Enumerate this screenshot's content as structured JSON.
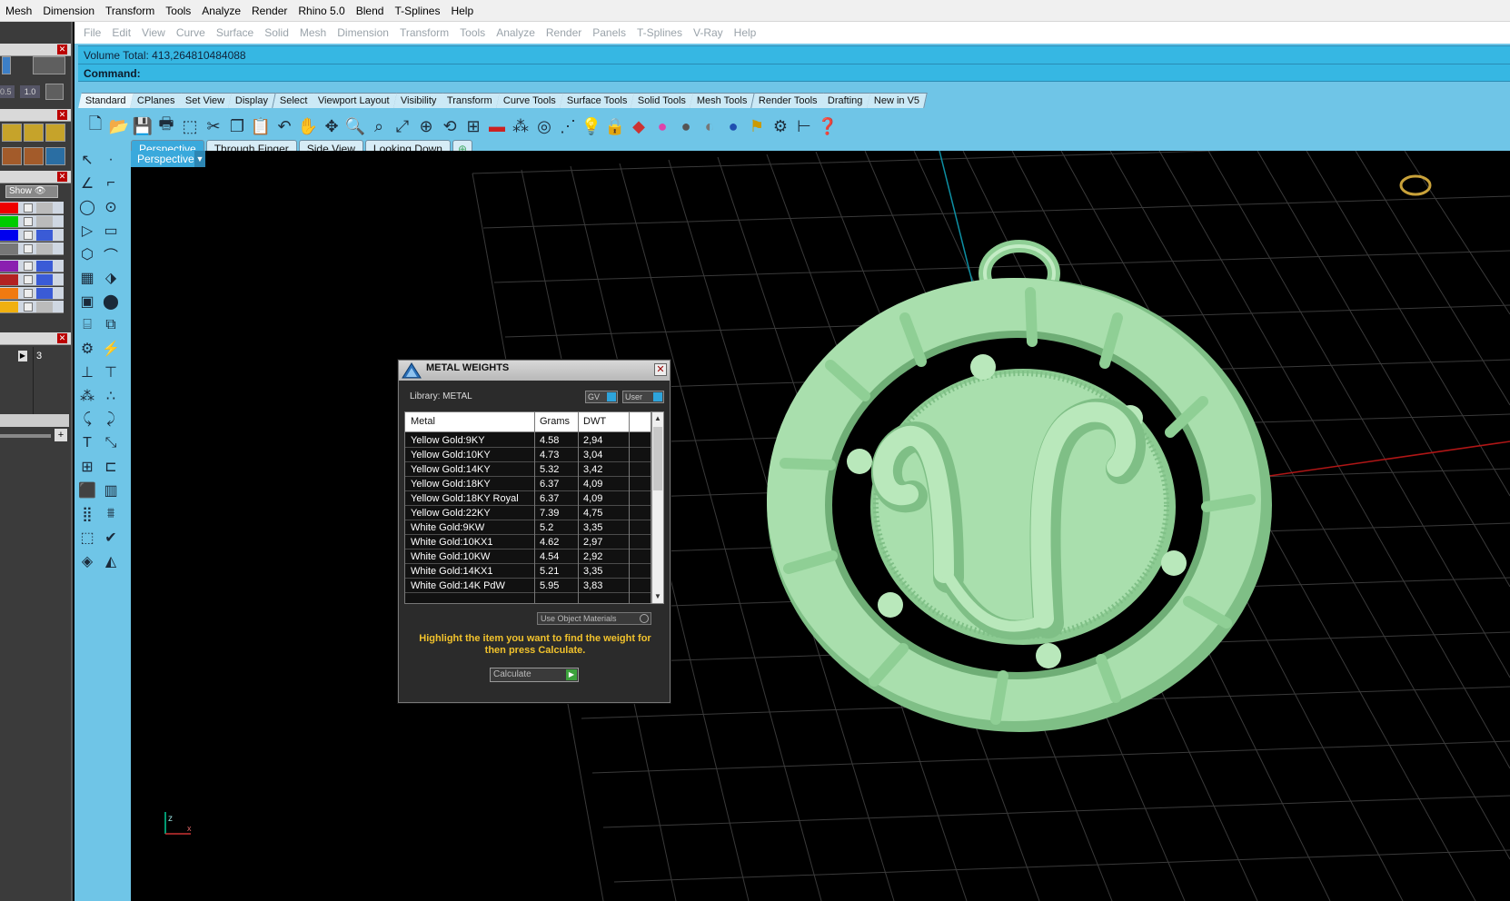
{
  "outer_menu": [
    "Mesh",
    "Dimension",
    "Transform",
    "Tools",
    "Analyze",
    "Render",
    "Rhino 5.0",
    "Blend",
    "T-Splines",
    "Help"
  ],
  "inner_menu": [
    "File",
    "Edit",
    "View",
    "Curve",
    "Surface",
    "Solid",
    "Mesh",
    "Dimension",
    "Transform",
    "Tools",
    "Analyze",
    "Render",
    "Panels",
    "T-Splines",
    "V-Ray",
    "Help"
  ],
  "status_line": "Volume Total: 413,264810484088",
  "command_label": "Command:",
  "toolbar_tabs": [
    "Standard",
    "CPlanes",
    "Set View",
    "Display",
    "Select",
    "Viewport Layout",
    "Visibility",
    "Transform",
    "Curve Tools",
    "Surface Tools",
    "Solid Tools",
    "Mesh Tools",
    "Render Tools",
    "Drafting",
    "New in V5"
  ],
  "viewport_tabs": [
    "Perspective",
    "Through Finger",
    "Side View",
    "Looking Down"
  ],
  "viewport_label": "Perspective",
  "left_panel": {
    "val1": "0.5",
    "val2": "1.0",
    "show_label": "Show",
    "item_num": "3"
  },
  "dialog": {
    "title": "METAL WEIGHTS",
    "library": "Library: METAL",
    "gv": "GV",
    "user": "User",
    "headers": [
      "Metal",
      "Grams",
      "DWT"
    ],
    "rows": [
      {
        "metal": "Yellow Gold:9KY",
        "grams": "4.58",
        "dwt": "2,94"
      },
      {
        "metal": "Yellow Gold:10KY",
        "grams": "4.73",
        "dwt": "3,04"
      },
      {
        "metal": "Yellow Gold:14KY",
        "grams": "5.32",
        "dwt": "3,42"
      },
      {
        "metal": "Yellow Gold:18KY",
        "grams": "6.37",
        "dwt": "4,09"
      },
      {
        "metal": "Yellow Gold:18KY Royal",
        "grams": "6.37",
        "dwt": "4,09"
      },
      {
        "metal": "Yellow Gold:22KY",
        "grams": "7.39",
        "dwt": "4,75"
      },
      {
        "metal": "White Gold:9KW",
        "grams": "5.2",
        "dwt": "3,35"
      },
      {
        "metal": "White Gold:10KX1",
        "grams": "4.62",
        "dwt": "2,97"
      },
      {
        "metal": "White Gold:10KW",
        "grams": "4.54",
        "dwt": "2,92"
      },
      {
        "metal": "White Gold:14KX1",
        "grams": "5.21",
        "dwt": "3,35"
      },
      {
        "metal": "White Gold:14K PdW",
        "grams": "5.95",
        "dwt": "3,83"
      }
    ],
    "use_materials": "Use Object Materials",
    "hint": "Highlight the item you want to find the weight for then press Calculate.",
    "calculate": "Calculate"
  },
  "colors": {
    "accent": "#36b7e3",
    "pendant": "#a9dfad",
    "hint": "#f1c22c"
  }
}
